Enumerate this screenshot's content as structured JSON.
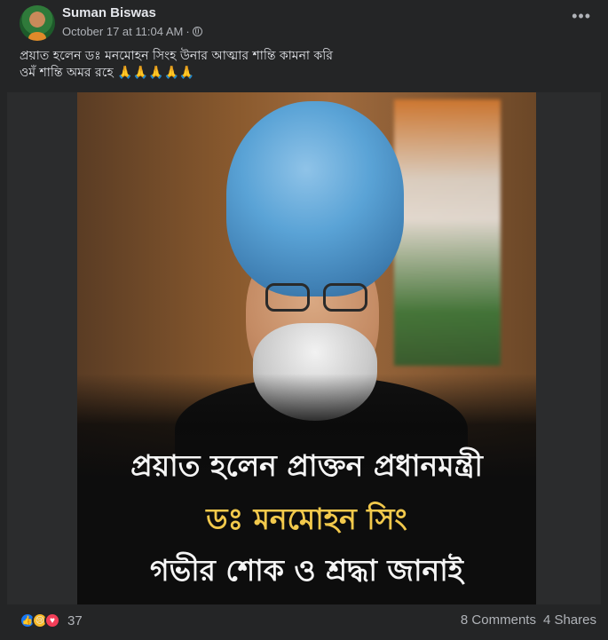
{
  "post": {
    "author": "Suman Biswas",
    "timestamp": "October 17 at 11:04 AM",
    "privacy_icon": "globe-icon",
    "more_icon": "ellipsis-icon",
    "caption_lines": [
      "প্রয়াত হলেন ডঃ মনমোহন সিংহ উনার আত্মার শান্তি কামনা করি",
      "ওমঁ শান্তি অমর রহে 🙏🙏🙏🙏🙏"
    ]
  },
  "image_text": {
    "line1": "প্রয়াত হলেন প্রাক্তন প্রধানমন্ত্রী",
    "line2": "ডঃ মনমোহন সিং",
    "line3": "গভীর শোক ও শ্রদ্ধা জানাই"
  },
  "footer": {
    "reaction_icons": [
      "like-icon",
      "sad-icon",
      "love-icon"
    ],
    "reaction_count": "37",
    "comments": "8 Comments",
    "shares": "4 Shares"
  },
  "colors": {
    "background": "#242526",
    "text": "#e4e6eb",
    "muted": "#b0b3b8",
    "headline_gold": "#f2c94c",
    "turban_blue": "#5aa3d6"
  }
}
